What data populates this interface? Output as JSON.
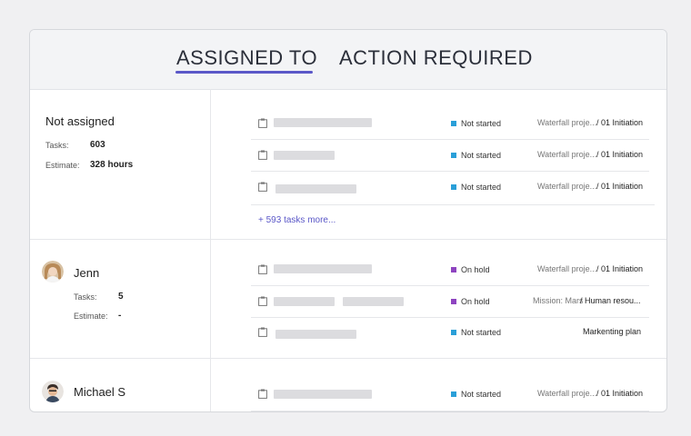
{
  "tabs": [
    {
      "label": "ASSIGNED TO",
      "active": true
    },
    {
      "label": "ACTION REQUIRED",
      "active": false
    }
  ],
  "colors": {
    "accent": "#5b58c8",
    "not_started": "#2a9fd8",
    "on_hold": "#8e44c0"
  },
  "groups": [
    {
      "name": "Not assigned",
      "tasks_label": "Tasks:",
      "tasks": "603",
      "estimate_label": "Estimate:",
      "estimate": "328 hours",
      "rows": [
        {
          "icon": "clipboard-icon",
          "status": "Not started",
          "project": "Waterfall proje...",
          "phase": "/ 01 Initiation"
        },
        {
          "icon": "clipboard-icon",
          "status": "Not started",
          "project": "Waterfall proje...",
          "phase": "/ 01 Initiation"
        },
        {
          "icon": "clipboard-icon",
          "status": "Not started",
          "project": "Waterfall proje...",
          "phase": "/ 01 Initiation"
        }
      ],
      "more": "+ 593 tasks more..."
    },
    {
      "name": "Jenn",
      "avatar": "avatar-jenn",
      "tasks_label": "Tasks:",
      "tasks": "5",
      "estimate_label": "Estimate:",
      "estimate": "-",
      "rows": [
        {
          "icon": "clipboard-icon",
          "status": "On hold",
          "project": "Waterfall proje...",
          "phase": "/ 01 Initiation"
        },
        {
          "icon": "clipboard-icon",
          "status": "On hold",
          "project": "Mission: Mars",
          "phase": "/ Human resou..."
        },
        {
          "icon": "clipboard-icon",
          "status": "Not started",
          "project": "",
          "phase": "Markenting plan"
        }
      ]
    },
    {
      "name": "Michael S",
      "avatar": "avatar-michael",
      "rows": [
        {
          "icon": "clipboard-icon",
          "status": "Not started",
          "project": "Waterfall proje...",
          "phase": "/ 01 Initiation"
        }
      ]
    }
  ]
}
